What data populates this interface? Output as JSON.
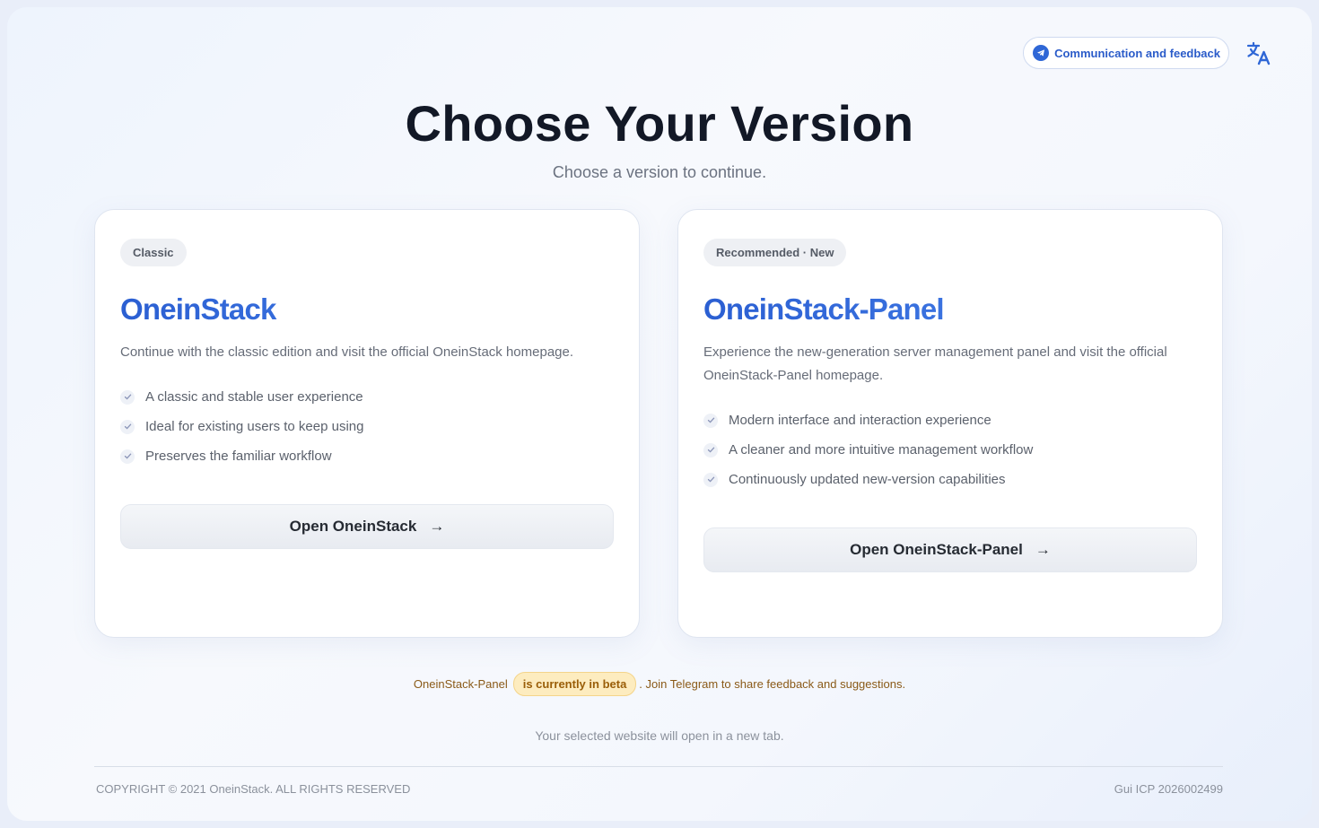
{
  "header": {
    "feedback_label": "Communication and feedback",
    "feedback_icon": "telegram-icon",
    "language_icon": "translate-icon"
  },
  "title": "Choose Your Version",
  "subtitle": "Choose a version to continue.",
  "cards": [
    {
      "tag": "Classic",
      "name": "OneinStack",
      "description": "Continue with the classic edition and visit the official OneinStack homepage.",
      "features": [
        "A classic and stable user experience",
        "Ideal for existing users to keep using",
        "Preserves the familiar workflow"
      ],
      "button_label": "Open OneinStack",
      "button_arrow": "→"
    },
    {
      "tag": "Recommended · New",
      "name": "OneinStack-Panel",
      "description": "Experience the new-generation server management panel and visit the official OneinStack-Panel homepage.",
      "features": [
        "Modern interface and interaction experience",
        "A cleaner and more intuitive management workflow",
        "Continuously updated new-version capabilities"
      ],
      "button_label": "Open OneinStack-Panel",
      "button_arrow": "→"
    }
  ],
  "beta_notice": {
    "prefix": "OneinStack-Panel",
    "badge": "is currently in beta",
    "suffix": ". Join Telegram to share feedback and suggestions."
  },
  "new_tab_note": "Your selected website will open in a new tab.",
  "footer": {
    "copyright": "COPYRIGHT © 2021 OneinStack. ALL RIGHTS RESERVED",
    "icp": "Gui ICP 2026002499"
  },
  "colors": {
    "accent": "#2b5fd2",
    "accent_light": "#4a86ee",
    "beta_bg": "#fdecbf",
    "beta_text": "#9a5e08"
  }
}
